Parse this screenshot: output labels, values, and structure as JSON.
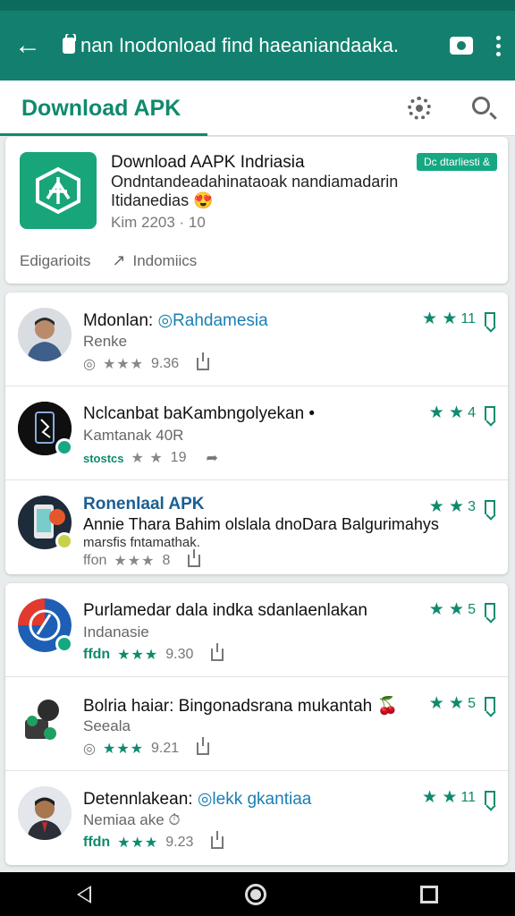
{
  "app_bar": {
    "title": "nan Inodonload  find  haeaniandaaka."
  },
  "tabs": {
    "active": "Download APK"
  },
  "featured": {
    "title": "Download AAPK Indriasia",
    "description": "Ondntandeadahinataoak nandiamadarin Itidanedias 😍",
    "meta": "Kim 2203 · 10",
    "badge": "Dc dtarliesti &",
    "tag1": "Edigarioits",
    "tag2": "Indomiics"
  },
  "group1": [
    {
      "title_prefix": "Mdonlan:",
      "title_hl": "Rahdamesia",
      "subtitle": "Renke",
      "meta_pre": "◎",
      "meta_stars": "★★★",
      "meta_score": "9.36",
      "rating_count": "11"
    },
    {
      "title": "Nclcanbat baKambngolyekan •",
      "subtitle": "Kamtanak 40R",
      "meta_pre": "stostcs",
      "meta_stars": "★ ★",
      "meta_score": "19",
      "rating_count": "4"
    },
    {
      "title": "Ronenlaal APK",
      "title2": "Annie Thara Bahim olslala dnoDara Balgurimahys",
      "subtitle": "marsfis fntamathak.",
      "meta_pre": "ffon",
      "meta_stars": "★★★",
      "meta_score": "8",
      "rating_count": "3"
    }
  ],
  "group2": [
    {
      "title": "Purlamedar dala indka sdanlaenlakan",
      "subtitle": "Indanasie",
      "meta_pre": "ffdn",
      "meta_stars": "★★★",
      "meta_score": "9.30",
      "rating_count": "5"
    },
    {
      "title": "Bolria haiar: Bingonadsrana mukantah 🍒",
      "subtitle": "Seeala",
      "meta_pre": "◎",
      "meta_stars": "★★★",
      "meta_score": "9.21",
      "rating_count": "5"
    },
    {
      "title_prefix": "Detennlakean:",
      "title_hl": "lekk gkantiaa",
      "subtitle": "Nemiaa ake ⏱",
      "meta_pre": "ffdn",
      "meta_stars": "★★★",
      "meta_score": "9.23",
      "rating_count": "11"
    }
  ],
  "colors": {
    "app_bar": "#13806f",
    "accent": "#0f8a6d"
  }
}
